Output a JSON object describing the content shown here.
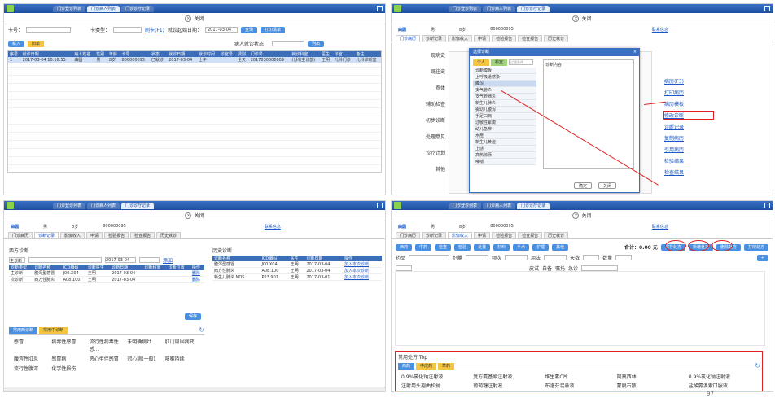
{
  "common": {
    "tabs": [
      "门诊登诊列表",
      "门诊病人列表",
      "门诊诊疗记录"
    ],
    "close_label": "关闭",
    "patient": {
      "name": "曲圆",
      "sex": "男",
      "age": "8岁",
      "id": "800000095"
    },
    "patient_link": "联系信息",
    "subtabs": [
      "门诊病历",
      "诊断记录",
      "影像收入",
      "申请",
      "检验报告",
      "检查报告",
      "历史就诊"
    ]
  },
  "panel1": {
    "card_label": "卡号：",
    "cardtype_label": "卡类型：",
    "read_card": "刷卡(F1)",
    "date_label": "就诊起始日期：",
    "date_value": "2017-03-04",
    "btn_search": "查询",
    "btn_print": "打印清单",
    "tab_new": "新入",
    "tab_old": "旧单",
    "status_label": "病人就诊状态：",
    "btn_list": "列出",
    "columns": [
      "序号",
      "就诊日期",
      "病人姓名",
      "性别",
      "年龄",
      "卡号",
      "状态",
      "就诊日期",
      "就诊时间",
      "诊室号",
      "费别",
      "门诊号",
      "就诊科室",
      "医生",
      "诊室",
      "备注"
    ],
    "rows": [
      [
        "1",
        "2017-03-04 10:16:55",
        "曲圆",
        "男",
        "8岁",
        "800000095",
        "已就诊",
        "2017-03-04",
        "上午",
        "",
        "全天",
        "2017030000009",
        "儿科(主诊部)",
        "王明",
        "儿科门诊",
        "儿科诊断室"
      ]
    ]
  },
  "panel2": {
    "form_labels": [
      "现病史",
      "既往史",
      "查体",
      "辅助检查",
      "初步诊断",
      "处理意见",
      "诊疗计划",
      "其他"
    ],
    "dialog_title": "选择诊断",
    "dialog_tab1": "个人",
    "dialog_tab2": "科室",
    "dialog_search": "过滤条件",
    "dialog_right_title": "诊断内容",
    "dialog_items": [
      "诊断模板",
      "上呼吸道感染",
      "腹泻",
      "支气管炎",
      "支气管肺炎",
      "新生儿肺炎",
      "婴幼儿腹泻",
      "手足口病",
      "过敏性紫癜",
      "幼儿急疹",
      "水痘",
      "新生儿黄疸",
      "上感",
      "高热惊厥",
      "哮喘"
    ],
    "dialog_ok": "确定",
    "dialog_cancel": "关闭",
    "right_links": [
      "病历(F3)",
      "打印病历",
      "病历模板",
      "修改诊断",
      "诊断记录",
      "复制病历",
      "引用病历",
      "检验结果",
      "检查结果",
      "病历(F5)"
    ]
  },
  "panel3": {
    "section_title": "西方诊断",
    "dx_label": "主诊断",
    "date_value": "2017-03-04",
    "btn_add": "添加",
    "columns": [
      "诊断类型",
      "诊断名称",
      "ICD编码",
      "诊断医生",
      "诊断日期",
      "诊断科室",
      "诊断位置",
      "操作"
    ],
    "rows": [
      [
        "主诊断",
        "腹泻型感冒",
        "J00.X04",
        "王明",
        "2017-03-04",
        "",
        "",
        "删除"
      ],
      [
        "次诊断",
        "西方性肺炎",
        "A08.100",
        "王明",
        "2017-03-04",
        "",
        "",
        "删除"
      ]
    ],
    "history_title": "历史诊断",
    "history_columns": [
      "诊断名称",
      "ICD编码",
      "医生",
      "诊断日期",
      "操作"
    ],
    "history_rows": [
      [
        "腹泻型感冒",
        "J00.X04",
        "王明",
        "2017-03-04",
        "加入本次诊断"
      ],
      [
        "西方性肺炎",
        "A08.100",
        "王明",
        "2017-03-04",
        "加入本次诊断"
      ],
      [
        "新生儿肺炎 NOS",
        "P23.901",
        "王明",
        "2017-03-01",
        "加入本次诊断"
      ]
    ],
    "btn_save": "保存",
    "common_tab1": "常用西诊断",
    "common_tab2": "常用中诊断",
    "common_items": [
      "感冒",
      "病毒性感冒",
      "流行性病毒性感...",
      "未明确病灶",
      "肛门周围病变",
      "腹泻性肛炎",
      "感冒病",
      "恶心型伴感冒",
      "冠心病(一般)",
      "咳嗽持续",
      "流行性腹泻",
      "化学性损伤"
    ]
  },
  "panel4": {
    "total_label": "合计：0.00 元",
    "type_buttons": [
      "西药",
      "中药",
      "检查",
      "检验",
      "处置",
      "材料",
      "手术",
      "护理",
      "其他"
    ],
    "action_buttons": [
      "保存处方",
      "新增处方",
      "删除处方",
      "打印处方"
    ],
    "filter_labels": [
      "药品",
      "剂量",
      "频次",
      "用法",
      "天数",
      "数量"
    ],
    "checks": [
      "皮试",
      "自备",
      "嘱托",
      "急诊"
    ],
    "bottom_title": "常用处方 Top",
    "bottom_tabs": [
      "西药",
      "中成药",
      "草药"
    ],
    "bottom_items": [
      "0.9%氯化钠注射液",
      "复方氨基酸注射液",
      "维生素C片",
      "阿莫西林",
      "0.9%氯化钠注射液",
      "注射用头孢曲松钠",
      "葡萄糖注射液",
      "布洛芬混悬液",
      "蒙脱石散",
      "盐酸氨溴索口服液"
    ],
    "page_number": "97"
  }
}
